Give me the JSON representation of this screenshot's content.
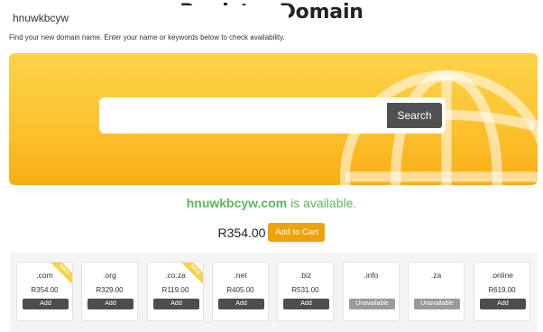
{
  "header": {
    "title": "Register Domain",
    "intro": "Find your new domain name. Enter your name or keywords below to check availability."
  },
  "search": {
    "value": "hnuwkbcyw",
    "button_label": "Search"
  },
  "result": {
    "domain": "hnuwkbcyw.com",
    "status_text": "is available.",
    "price": "R354.00",
    "add_to_cart_label": "Add to Cart"
  },
  "tlds": [
    {
      "name": ".com",
      "price": "R354.00",
      "button": "Add",
      "available": true,
      "sale": true,
      "sale_label": "SALE"
    },
    {
      "name": ".org",
      "price": "R329.00",
      "button": "Add",
      "available": true,
      "sale": false
    },
    {
      "name": ".co.za",
      "price": "R119.00",
      "button": "Add",
      "available": true,
      "sale": true,
      "sale_label": "SALE"
    },
    {
      "name": ".net",
      "price": "R405.00",
      "button": "Add",
      "available": true,
      "sale": false
    },
    {
      "name": ".biz",
      "price": "R531.00",
      "button": "Add",
      "available": true,
      "sale": false
    },
    {
      "name": ".info",
      "price": "",
      "button": "Unavailable",
      "available": false,
      "sale": false
    },
    {
      "name": ".za",
      "price": "",
      "button": "Unavailable",
      "available": false,
      "sale": false
    },
    {
      "name": ".online",
      "price": "R619.00",
      "button": "Add",
      "available": true,
      "sale": false
    }
  ],
  "colors": {
    "hero_top": "#fdd34a",
    "hero_bottom": "#f9ad13",
    "available_green": "#5cb85c",
    "cart_orange": "#f0a20b",
    "button_dark": "#4d4d4d",
    "button_disabled": "#9a9a9a"
  },
  "icons": {
    "hero_graphic": "globe-icon"
  }
}
